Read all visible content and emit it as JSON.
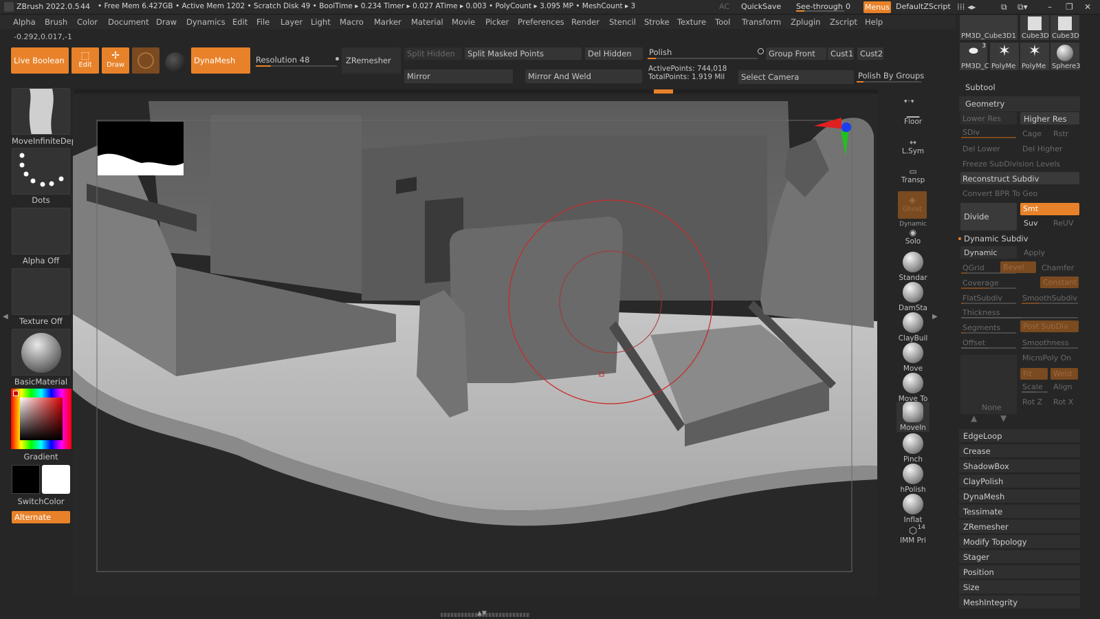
{
  "titlebar": {
    "app": "ZBrush 2022.0.5",
    "num": "44",
    "status": "• Free Mem 6.427GB • Active Mem 1202 • Scratch Disk 49 •  BoolTime ▸ 0.234 Timer ▸ 0.027 ATime ▸ 0.003 • PolyCount ▸ 3.095 MP  • MeshCount ▸ 3",
    "ac": "AC",
    "quicksave": "QuickSave",
    "see_through_label": "See-through",
    "see_through_value": "0",
    "see_through_fraction": 0.0,
    "menus": "Menus",
    "script": "DefaultZScript"
  },
  "menubar": [
    "Alpha",
    "Brush",
    "Color",
    "Document",
    "Draw",
    "Dynamics",
    "Edit",
    "File",
    "Layer",
    "Light",
    "Macro",
    "Marker",
    "Material",
    "Movie",
    "Picker",
    "Preferences",
    "Render",
    "Stencil",
    "Stroke",
    "Texture",
    "Tool",
    "Transform",
    "Zplugin",
    "Zscript",
    "Help"
  ],
  "coords": "-0.292,0.017,-1",
  "toolbar": {
    "live_boolean": "Live Boolean",
    "edit": "Edit",
    "draw": "Draw",
    "dynamesh": "DynaMesh",
    "resolution_label": "Resolution",
    "resolution_value": "48",
    "zremesher": "ZRemesher",
    "split_hidden": "Split Hidden",
    "split_masked": "Split Masked Points",
    "del_hidden": "Del Hidden",
    "polish": "Polish",
    "group_front": "Group Front",
    "cust1": "Cust1",
    "cust2": "Cust2",
    "mirror": "Mirror",
    "mirror_weld": "Mirror And Weld",
    "active_points": "ActivePoints: 744,018",
    "total_points": "TotalPoints: 1.919 Mil",
    "select_camera": "Select Camera",
    "polish_groups": "Polish By Groups"
  },
  "left_shelf": {
    "brush": "MoveInfiniteDep",
    "stroke": "Dots",
    "alpha": "Alpha Off",
    "texture": "Texture Off",
    "material": "BasicMaterial",
    "gradient": "Gradient",
    "switch_color": "SwitchColor",
    "alternate": "Alternate"
  },
  "right_shelf": [
    {
      "label": "Floor",
      "icon": "floor-icon"
    },
    {
      "label": "L.Sym",
      "icon": "lsym-icon"
    },
    {
      "label": "Transp",
      "icon": "transp-icon"
    },
    {
      "label": "Ghost",
      "icon": "ghost-icon"
    },
    {
      "label": "Solo",
      "icon": "solo-icon",
      "sub": "Dynamic"
    },
    {
      "label": "Standar",
      "icon": "standard-brush-icon"
    },
    {
      "label": "DamSta",
      "icon": "damstandard-brush-icon"
    },
    {
      "label": "ClayBuil",
      "icon": "claybuildup-brush-icon"
    },
    {
      "label": "Move",
      "icon": "move-brush-icon"
    },
    {
      "label": "Move To",
      "icon": "movetopo-brush-icon"
    },
    {
      "label": "MoveIn",
      "icon": "moveinfinite-brush-icon"
    },
    {
      "label": "Pinch",
      "icon": "pinch-brush-icon"
    },
    {
      "label": "hPolish",
      "icon": "hpolish-brush-icon"
    },
    {
      "label": "Inflat",
      "icon": "inflate-brush-icon"
    },
    {
      "label": "IMM Pri",
      "icon": "imm-primitives-icon",
      "badge": "14"
    }
  ],
  "tool_thumbs": [
    {
      "label": "PM3D_Cube3D1"
    },
    {
      "label": "Cube3D"
    },
    {
      "label": "Cube3D"
    },
    {
      "label": "PM3D_C",
      "badge": "3"
    },
    {
      "label": "PolyMe"
    },
    {
      "label": "PolyMe"
    },
    {
      "label": "Sphere3"
    }
  ],
  "panel": {
    "subtool": "Subtool",
    "geometry": "Geometry",
    "lower_res": "Lower Res",
    "higher_res": "Higher Res",
    "sdiv": "SDiv",
    "cage": "Cage",
    "rstr": "Rstr",
    "del_lower": "Del Lower",
    "del_higher": "Del Higher",
    "freeze": "Freeze SubDivision Levels",
    "reconstruct": "Reconstruct Subdiv",
    "convert_bpr": "Convert BPR To Geo",
    "divide": "Divide",
    "smt": "Smt",
    "suv": "Suv",
    "reuv": "ReUV",
    "dynamic_subdiv": "Dynamic Subdiv",
    "dynamic": "Dynamic",
    "apply": "Apply",
    "qgrid": "QGrid",
    "bevel": "Bevel",
    "chamfer": "Chamfer",
    "coverage": "Coverage",
    "constant": "Constant",
    "flatsubdiv": "FlatSubdiv",
    "smoothsubdiv": "SmoothSubdiv",
    "thickness": "Thickness",
    "segments": "Segments",
    "post_subdiv": "Post SubDiv",
    "offset": "Offset",
    "smoothness": "Smoothness",
    "micropoly": "MicroPoly On",
    "none": "None",
    "fit": "Fit",
    "weld": "Weld",
    "scale": "Scale",
    "align": "Align",
    "rotz": "Rot Z",
    "rotx": "Rot X",
    "sections": [
      "EdgeLoop",
      "Crease",
      "ShadowBox",
      "ClayPolish",
      "DynaMesh",
      "Tessimate",
      "ZRemesher",
      "Modify Topology",
      "Stager",
      "Position",
      "Size",
      "MeshIntegrity"
    ]
  },
  "colors": {
    "accent": "#e8822a",
    "bg": "#262626",
    "panel": "#313131"
  }
}
